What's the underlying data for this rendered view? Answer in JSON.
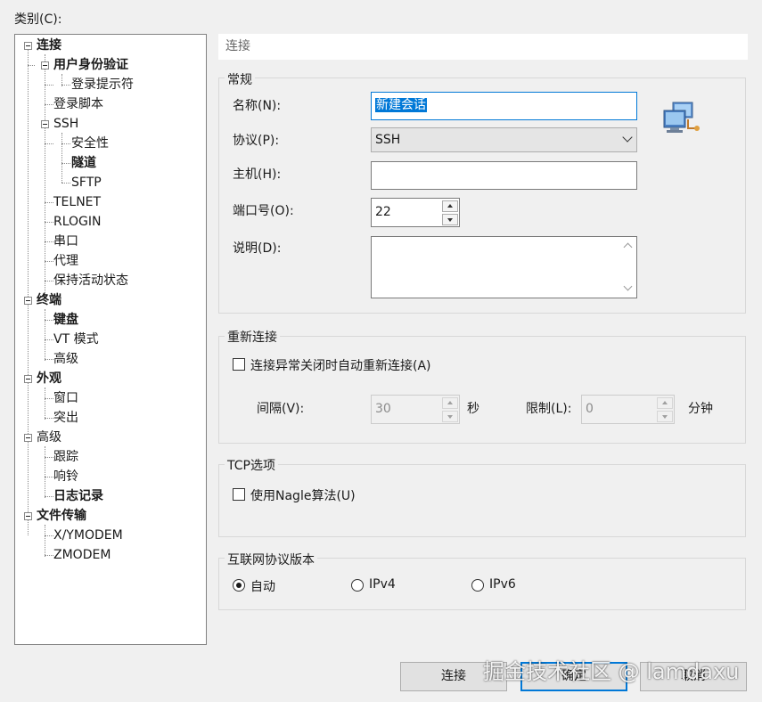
{
  "category_label": "类别(C):",
  "tree": {
    "items": [
      {
        "label": "连接",
        "bold": true
      },
      {
        "label": "用户身份验证",
        "bold": true
      },
      {
        "label": "登录提示符",
        "bold": false
      },
      {
        "label": "登录脚本",
        "bold": false
      },
      {
        "label": "SSH",
        "bold": false
      },
      {
        "label": "安全性",
        "bold": false
      },
      {
        "label": "隧道",
        "bold": true
      },
      {
        "label": "SFTP",
        "bold": false
      },
      {
        "label": "TELNET",
        "bold": false
      },
      {
        "label": "RLOGIN",
        "bold": false
      },
      {
        "label": "串口",
        "bold": false
      },
      {
        "label": "代理",
        "bold": false
      },
      {
        "label": "保持活动状态",
        "bold": false
      },
      {
        "label": "终端",
        "bold": true
      },
      {
        "label": "键盘",
        "bold": true
      },
      {
        "label": "VT 模式",
        "bold": false
      },
      {
        "label": "高级",
        "bold": false
      },
      {
        "label": "外观",
        "bold": true
      },
      {
        "label": "窗口",
        "bold": false
      },
      {
        "label": "突出",
        "bold": false
      },
      {
        "label": "高级",
        "bold": false
      },
      {
        "label": "跟踪",
        "bold": false
      },
      {
        "label": "响铃",
        "bold": false
      },
      {
        "label": "日志记录",
        "bold": true
      },
      {
        "label": "文件传输",
        "bold": true
      },
      {
        "label": "X/YMODEM",
        "bold": false
      },
      {
        "label": "ZMODEM",
        "bold": false
      }
    ]
  },
  "section_title": "连接",
  "general": {
    "title": "常规",
    "name_label": "名称(N):",
    "name_value": "新建会话",
    "protocol_label": "协议(P):",
    "protocol_value": "SSH",
    "host_label": "主机(H):",
    "host_value": "",
    "port_label": "端口号(O):",
    "port_value": "22",
    "desc_label": "说明(D):",
    "desc_value": "",
    "icon": "network-session-icon"
  },
  "reconnect": {
    "title": "重新连接",
    "checkbox_label": "连接异常关闭时自动重新连接(A)",
    "checked": false,
    "interval_label": "间隔(V):",
    "interval_value": "30",
    "interval_unit": "秒",
    "limit_label": "限制(L):",
    "limit_value": "0",
    "limit_unit": "分钟"
  },
  "tcp": {
    "title": "TCP选项",
    "nagle_label": "使用Nagle算法(U)",
    "checked": false
  },
  "ip_version": {
    "title": "互联网协议版本",
    "options": [
      "自动",
      "IPv4",
      "IPv6"
    ],
    "selected": "自动"
  },
  "buttons": {
    "connect": "连接",
    "ok": "确定",
    "cancel": "取消"
  },
  "watermark": "掘金技术社区 @ lamdaxu"
}
